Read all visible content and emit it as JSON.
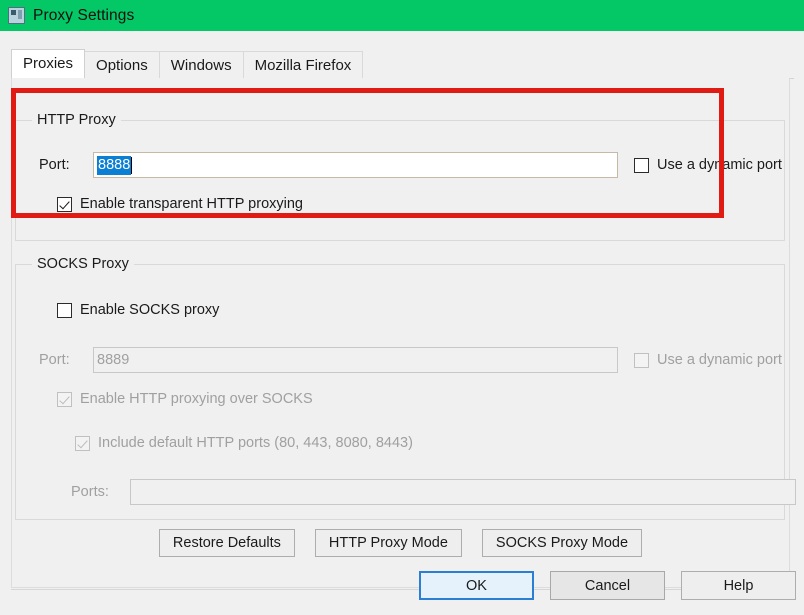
{
  "window": {
    "title": "Proxy Settings",
    "icon": "proxy-app-icon",
    "titlebar_color": "#04c866"
  },
  "tabs": [
    {
      "label": "Proxies",
      "active": true
    },
    {
      "label": "Options",
      "active": false
    },
    {
      "label": "Windows",
      "active": false
    },
    {
      "label": "Mozilla Firefox",
      "active": false
    }
  ],
  "http_proxy": {
    "group_title": "HTTP Proxy",
    "port_label": "Port:",
    "port_value": "8888",
    "port_selected": true,
    "dynamic_port_label": "Use a dynamic port",
    "dynamic_port_checked": false,
    "transparent_label": "Enable transparent HTTP proxying",
    "transparent_checked": true
  },
  "socks_proxy": {
    "group_title": "SOCKS Proxy",
    "enable_label": "Enable SOCKS proxy",
    "enable_checked": false,
    "port_label": "Port:",
    "port_value": "8889",
    "port_disabled": true,
    "dynamic_port_label": "Use a dynamic port",
    "dynamic_port_checked": false,
    "http_over_socks_label": "Enable HTTP proxying over SOCKS",
    "http_over_socks_checked": true,
    "default_ports_label": "Include default HTTP ports (80, 443, 8080, 8443)",
    "default_ports_checked": true,
    "ports_label": "Ports:",
    "ports_value": ""
  },
  "mode_buttons": {
    "restore_defaults": "Restore Defaults",
    "http_proxy_mode": "HTTP Proxy Mode",
    "socks_proxy_mode": "SOCKS Proxy Mode"
  },
  "dialog_buttons": {
    "ok": "OK",
    "cancel": "Cancel",
    "help": "Help"
  },
  "annotation": {
    "color": "#e01b13",
    "shape": "rectangle"
  }
}
